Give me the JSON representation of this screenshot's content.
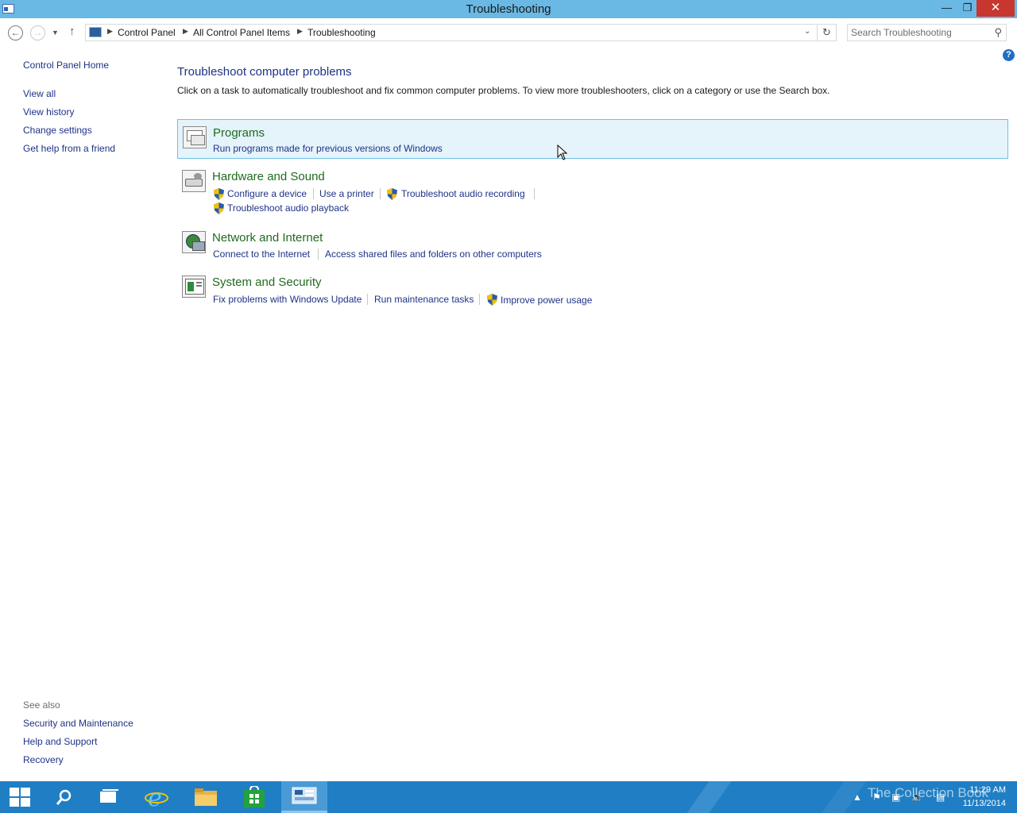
{
  "window": {
    "title": "Troubleshooting"
  },
  "address": {
    "crumbs": [
      "Control Panel",
      "All Control Panel Items",
      "Troubleshooting"
    ]
  },
  "search": {
    "placeholder": "Search Troubleshooting"
  },
  "sidebar": {
    "home": "Control Panel Home",
    "items": [
      "View all",
      "View history",
      "Change settings",
      "Get help from a friend"
    ],
    "see_also_label": "See also",
    "see_also": [
      "Security and Maintenance",
      "Help and Support",
      "Recovery"
    ]
  },
  "main": {
    "heading": "Troubleshoot computer problems",
    "description": "Click on a task to automatically troubleshoot and fix common computer problems. To view more troubleshooters, click on a category or use the Search box.",
    "categories": [
      {
        "title": "Programs",
        "tasks": [
          "Run programs made for previous versions of Windows"
        ]
      },
      {
        "title": "Hardware and Sound",
        "tasks": [
          "Configure a device",
          "Use a printer",
          "Troubleshoot audio recording",
          "Troubleshoot audio playback"
        ]
      },
      {
        "title": "Network and Internet",
        "tasks": [
          "Connect to the Internet",
          "Access shared files and folders on other computers"
        ]
      },
      {
        "title": "System and Security",
        "tasks": [
          "Fix problems with Windows Update",
          "Run maintenance tasks",
          "Improve power usage"
        ]
      }
    ]
  },
  "taskbar": {
    "clock_time": "11:29 AM",
    "clock_date": "11/13/2014",
    "watermark": "The Collection Book"
  },
  "colors": {
    "titlebar": "#6ab8e4",
    "link": "#1e3287",
    "category_title": "#1f6b1f",
    "selection_bg": "#e5f3fb",
    "selection_border": "#70c0e7",
    "taskbar": "#1f7ec4",
    "close_button": "#c7372f"
  }
}
